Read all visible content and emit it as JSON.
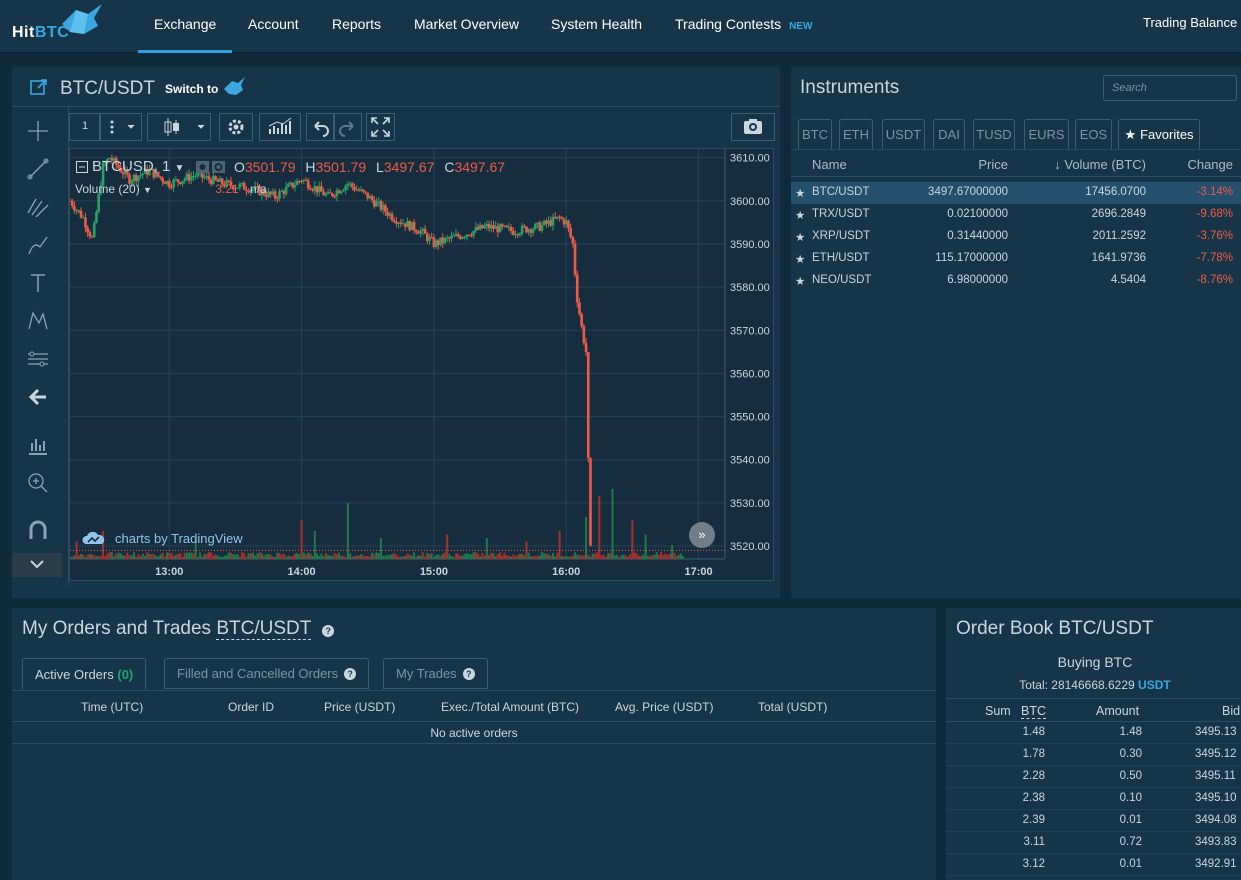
{
  "brand": {
    "logo_text_a": "Hit",
    "logo_text_b": "BTC"
  },
  "nav": {
    "items": [
      {
        "label": "Exchange",
        "active": true
      },
      {
        "label": "Account"
      },
      {
        "label": "Reports"
      },
      {
        "label": "Market Overview"
      },
      {
        "label": "System Health"
      },
      {
        "label": "Trading Contests"
      }
    ],
    "new_badge": "NEW",
    "right_label": "Trading Balance"
  },
  "chart_panel": {
    "pair": "BTC/USDT",
    "switch_to": "Switch to",
    "interval": "1",
    "symbol_label": "BTCUSD, 1",
    "ohlc": {
      "o_label": "O",
      "o": "3501.79",
      "h_label": "H",
      "h": "3501.79",
      "l_label": "L",
      "l": "3497.67",
      "c_label": "C",
      "c": "3497.67"
    },
    "volume_label": "Volume (20)",
    "volume_value": "3.21",
    "volume_na": "n/a",
    "watermark": "charts by TradingView"
  },
  "chart_data": {
    "type": "candlestick",
    "title": "BTCUSD, 1",
    "y_ticks": [
      "3610.00",
      "3600.00",
      "3590.00",
      "3580.00",
      "3570.00",
      "3560.00",
      "3550.00",
      "3540.00",
      "3530.00",
      "3520.00"
    ],
    "x_ticks": [
      "13:00",
      "14:00",
      "15:00",
      "16:00",
      "17:00"
    ],
    "ylim": [
      3517,
      3612
    ],
    "xlim": [
      12.25,
      17.2
    ],
    "price_path": [
      [
        12.25,
        3600
      ],
      [
        12.35,
        3596
      ],
      [
        12.42,
        3591
      ],
      [
        12.5,
        3608
      ],
      [
        12.55,
        3610
      ],
      [
        12.7,
        3605
      ],
      [
        12.85,
        3607
      ],
      [
        13.0,
        3604
      ],
      [
        13.2,
        3606
      ],
      [
        13.4,
        3604
      ],
      [
        13.6,
        3603
      ],
      [
        13.8,
        3601
      ],
      [
        14.0,
        3605
      ],
      [
        14.2,
        3601
      ],
      [
        14.35,
        3604
      ],
      [
        14.5,
        3601
      ],
      [
        14.7,
        3596
      ],
      [
        14.9,
        3593
      ],
      [
        15.0,
        3590
      ],
      [
        15.2,
        3592
      ],
      [
        15.4,
        3594
      ],
      [
        15.6,
        3593
      ],
      [
        15.8,
        3594
      ],
      [
        15.95,
        3596
      ],
      [
        16.0,
        3595
      ],
      [
        16.05,
        3590
      ],
      [
        16.08,
        3578
      ],
      [
        16.12,
        3570
      ],
      [
        16.15,
        3565
      ],
      [
        16.18,
        3519
      ]
    ],
    "volume_spikes": [
      [
        12.3,
        0.25
      ],
      [
        12.5,
        0.4
      ],
      [
        13.2,
        0.3
      ],
      [
        14.0,
        0.55
      ],
      [
        14.1,
        0.4
      ],
      [
        14.35,
        0.8
      ],
      [
        14.6,
        0.3
      ],
      [
        15.1,
        0.35
      ],
      [
        15.4,
        0.3
      ],
      [
        15.7,
        0.25
      ],
      [
        15.95,
        0.4
      ],
      [
        16.15,
        0.6
      ],
      [
        16.25,
        0.9
      ],
      [
        16.35,
        1.0
      ],
      [
        16.5,
        0.55
      ],
      [
        16.6,
        0.35
      ],
      [
        16.8,
        0.2
      ]
    ]
  },
  "instruments": {
    "title": "Instruments",
    "search_placeholder": "Search",
    "tabs": [
      "BTC",
      "ETH",
      "USDT",
      "DAI",
      "TUSD",
      "EURS",
      "EOS"
    ],
    "favorites_tab": "Favorites",
    "columns": {
      "name": "Name",
      "price": "Price",
      "volume": "Volume (BTC)",
      "change": "Change"
    },
    "rows": [
      {
        "name": "BTC/USDT",
        "price": "3497.67000000",
        "volume": "17456.0700",
        "change": "-3.14%"
      },
      {
        "name": "TRX/USDT",
        "price": "0.02100000",
        "volume": "2696.2849",
        "change": "-9.68%"
      },
      {
        "name": "XRP/USDT",
        "price": "0.31440000",
        "volume": "2011.2592",
        "change": "-3.76%"
      },
      {
        "name": "ETH/USDT",
        "price": "115.17000000",
        "volume": "1641.9736",
        "change": "-7.78%"
      },
      {
        "name": "NEO/USDT",
        "price": "6.98000000",
        "volume": "4.5404",
        "change": "-8.76%"
      }
    ]
  },
  "orders": {
    "title": "My Orders and Trades",
    "pair": "BTC/USDT",
    "tabs": {
      "active": "Active Orders",
      "active_count": "(0)",
      "filled": "Filled and Cancelled Orders",
      "trades": "My Trades"
    },
    "columns": [
      "Time (UTC)",
      "Order ID",
      "Price (USDT)",
      "Exec./Total Amount (BTC)",
      "Avg. Price (USDT)",
      "Total (USDT)"
    ],
    "empty_text": "No active orders"
  },
  "order_book": {
    "title": "Order Book BTC/USDT",
    "buying_label": "Buying BTC",
    "total_label": "Total: 28146668.6229",
    "total_currency": "USDT",
    "columns": {
      "sum": "Sum",
      "sum_unit": "BTC",
      "amount": "Amount",
      "bid": "Bid"
    },
    "rows": [
      {
        "sum": "1.48",
        "amount": "1.48",
        "bid": "3495.13"
      },
      {
        "sum": "1.78",
        "amount": "0.30",
        "bid": "3495.12"
      },
      {
        "sum": "2.28",
        "amount": "0.50",
        "bid": "3495.11"
      },
      {
        "sum": "2.38",
        "amount": "0.10",
        "bid": "3495.10"
      },
      {
        "sum": "2.39",
        "amount": "0.01",
        "bid": "3494.08"
      },
      {
        "sum": "3.11",
        "amount": "0.72",
        "bid": "3493.83"
      },
      {
        "sum": "3.12",
        "amount": "0.01",
        "bid": "3492.91"
      }
    ]
  },
  "colors": {
    "up": "#26a269",
    "down": "#ef5a47",
    "accent": "#2f9fde"
  }
}
